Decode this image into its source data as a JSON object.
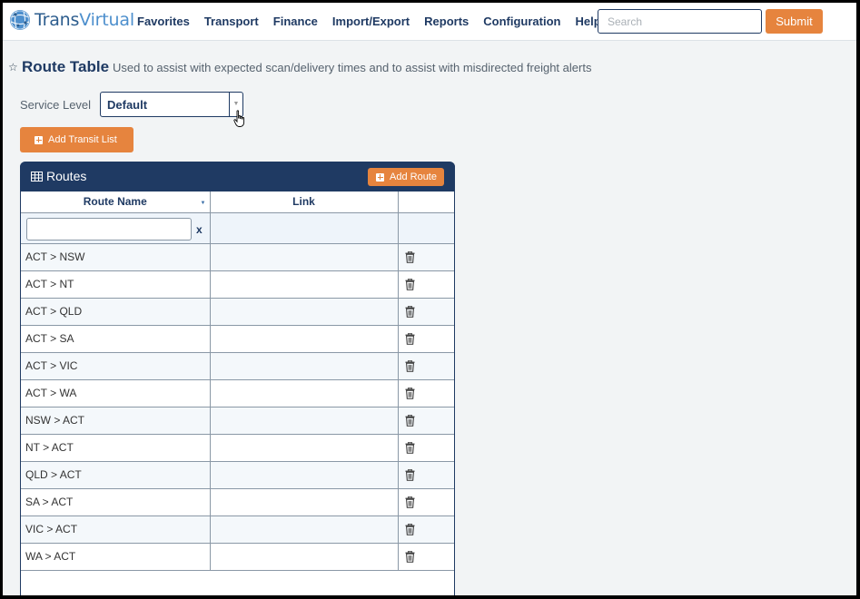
{
  "nav": {
    "logo_text_dark": "Trans",
    "logo_text_light": "Virtual",
    "menu": [
      "Favorites",
      "Transport",
      "Finance",
      "Import/Export",
      "Reports",
      "Configuration",
      "Help"
    ],
    "search_placeholder": "Search",
    "submit_label": "Submit"
  },
  "page": {
    "title": "Route Table",
    "description": "Used to assist with expected scan/delivery times and to assist with misdirected freight alerts"
  },
  "service_level": {
    "label": "Service Level",
    "value": "Default"
  },
  "add_transit_label": "Add Transit List",
  "routes_panel": {
    "title": "Routes",
    "add_route_label": "Add Route",
    "columns": [
      "Route Name",
      "Link"
    ],
    "filter_clear": "x",
    "rows": [
      "ACT > NSW",
      "ACT > NT",
      "ACT > QLD",
      "ACT > SA",
      "ACT > VIC",
      "ACT > WA",
      "NSW > ACT",
      "NT > ACT",
      "QLD > ACT",
      "SA > ACT",
      "VIC > ACT",
      "WA > ACT"
    ]
  },
  "colors": {
    "brand_navy": "#1f3a63",
    "accent_orange": "#e6843e",
    "logo_blue": "#4d8fcd"
  },
  "icons": {
    "favorite": "star-icon",
    "routes": "table-icon",
    "add": "plus-square-icon",
    "delete": "trash-icon",
    "sort": "sort-down-icon"
  }
}
